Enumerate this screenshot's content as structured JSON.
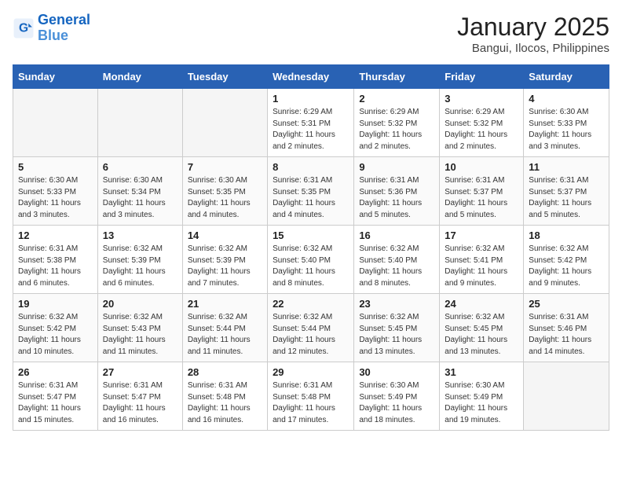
{
  "header": {
    "logo_line1": "General",
    "logo_line2": "Blue",
    "month_title": "January 2025",
    "location": "Bangui, Ilocos, Philippines"
  },
  "weekdays": [
    "Sunday",
    "Monday",
    "Tuesday",
    "Wednesday",
    "Thursday",
    "Friday",
    "Saturday"
  ],
  "weeks": [
    [
      {
        "num": "",
        "info": "",
        "empty": true
      },
      {
        "num": "",
        "info": "",
        "empty": true
      },
      {
        "num": "",
        "info": "",
        "empty": true
      },
      {
        "num": "1",
        "info": "Sunrise: 6:29 AM\nSunset: 5:31 PM\nDaylight: 11 hours\nand 2 minutes."
      },
      {
        "num": "2",
        "info": "Sunrise: 6:29 AM\nSunset: 5:32 PM\nDaylight: 11 hours\nand 2 minutes."
      },
      {
        "num": "3",
        "info": "Sunrise: 6:29 AM\nSunset: 5:32 PM\nDaylight: 11 hours\nand 2 minutes."
      },
      {
        "num": "4",
        "info": "Sunrise: 6:30 AM\nSunset: 5:33 PM\nDaylight: 11 hours\nand 3 minutes."
      }
    ],
    [
      {
        "num": "5",
        "info": "Sunrise: 6:30 AM\nSunset: 5:33 PM\nDaylight: 11 hours\nand 3 minutes."
      },
      {
        "num": "6",
        "info": "Sunrise: 6:30 AM\nSunset: 5:34 PM\nDaylight: 11 hours\nand 3 minutes."
      },
      {
        "num": "7",
        "info": "Sunrise: 6:30 AM\nSunset: 5:35 PM\nDaylight: 11 hours\nand 4 minutes."
      },
      {
        "num": "8",
        "info": "Sunrise: 6:31 AM\nSunset: 5:35 PM\nDaylight: 11 hours\nand 4 minutes."
      },
      {
        "num": "9",
        "info": "Sunrise: 6:31 AM\nSunset: 5:36 PM\nDaylight: 11 hours\nand 5 minutes."
      },
      {
        "num": "10",
        "info": "Sunrise: 6:31 AM\nSunset: 5:37 PM\nDaylight: 11 hours\nand 5 minutes."
      },
      {
        "num": "11",
        "info": "Sunrise: 6:31 AM\nSunset: 5:37 PM\nDaylight: 11 hours\nand 5 minutes."
      }
    ],
    [
      {
        "num": "12",
        "info": "Sunrise: 6:31 AM\nSunset: 5:38 PM\nDaylight: 11 hours\nand 6 minutes."
      },
      {
        "num": "13",
        "info": "Sunrise: 6:32 AM\nSunset: 5:39 PM\nDaylight: 11 hours\nand 6 minutes."
      },
      {
        "num": "14",
        "info": "Sunrise: 6:32 AM\nSunset: 5:39 PM\nDaylight: 11 hours\nand 7 minutes."
      },
      {
        "num": "15",
        "info": "Sunrise: 6:32 AM\nSunset: 5:40 PM\nDaylight: 11 hours\nand 8 minutes."
      },
      {
        "num": "16",
        "info": "Sunrise: 6:32 AM\nSunset: 5:40 PM\nDaylight: 11 hours\nand 8 minutes."
      },
      {
        "num": "17",
        "info": "Sunrise: 6:32 AM\nSunset: 5:41 PM\nDaylight: 11 hours\nand 9 minutes."
      },
      {
        "num": "18",
        "info": "Sunrise: 6:32 AM\nSunset: 5:42 PM\nDaylight: 11 hours\nand 9 minutes."
      }
    ],
    [
      {
        "num": "19",
        "info": "Sunrise: 6:32 AM\nSunset: 5:42 PM\nDaylight: 11 hours\nand 10 minutes."
      },
      {
        "num": "20",
        "info": "Sunrise: 6:32 AM\nSunset: 5:43 PM\nDaylight: 11 hours\nand 11 minutes."
      },
      {
        "num": "21",
        "info": "Sunrise: 6:32 AM\nSunset: 5:44 PM\nDaylight: 11 hours\nand 11 minutes."
      },
      {
        "num": "22",
        "info": "Sunrise: 6:32 AM\nSunset: 5:44 PM\nDaylight: 11 hours\nand 12 minutes."
      },
      {
        "num": "23",
        "info": "Sunrise: 6:32 AM\nSunset: 5:45 PM\nDaylight: 11 hours\nand 13 minutes."
      },
      {
        "num": "24",
        "info": "Sunrise: 6:32 AM\nSunset: 5:45 PM\nDaylight: 11 hours\nand 13 minutes."
      },
      {
        "num": "25",
        "info": "Sunrise: 6:31 AM\nSunset: 5:46 PM\nDaylight: 11 hours\nand 14 minutes."
      }
    ],
    [
      {
        "num": "26",
        "info": "Sunrise: 6:31 AM\nSunset: 5:47 PM\nDaylight: 11 hours\nand 15 minutes."
      },
      {
        "num": "27",
        "info": "Sunrise: 6:31 AM\nSunset: 5:47 PM\nDaylight: 11 hours\nand 16 minutes."
      },
      {
        "num": "28",
        "info": "Sunrise: 6:31 AM\nSunset: 5:48 PM\nDaylight: 11 hours\nand 16 minutes."
      },
      {
        "num": "29",
        "info": "Sunrise: 6:31 AM\nSunset: 5:48 PM\nDaylight: 11 hours\nand 17 minutes."
      },
      {
        "num": "30",
        "info": "Sunrise: 6:30 AM\nSunset: 5:49 PM\nDaylight: 11 hours\nand 18 minutes."
      },
      {
        "num": "31",
        "info": "Sunrise: 6:30 AM\nSunset: 5:49 PM\nDaylight: 11 hours\nand 19 minutes."
      },
      {
        "num": "",
        "info": "",
        "empty": true
      }
    ]
  ]
}
